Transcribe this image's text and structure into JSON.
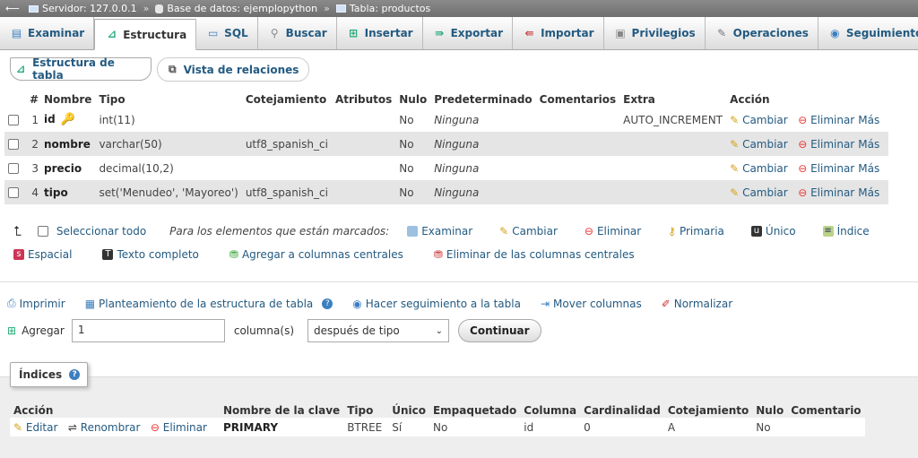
{
  "breadcrumb": {
    "server": "Servidor: 127.0.0.1",
    "database": "Base de datos: ejemplopython",
    "table": "Tabla: productos"
  },
  "tabs": [
    {
      "label": "Examinar",
      "icon": "browse-icon"
    },
    {
      "label": "Estructura",
      "icon": "structure-icon"
    },
    {
      "label": "SQL",
      "icon": "sql-icon"
    },
    {
      "label": "Buscar",
      "icon": "search-icon"
    },
    {
      "label": "Insertar",
      "icon": "insert-icon"
    },
    {
      "label": "Exportar",
      "icon": "export-icon"
    },
    {
      "label": "Importar",
      "icon": "import-icon"
    },
    {
      "label": "Privilegios",
      "icon": "privileges-icon"
    },
    {
      "label": "Operaciones",
      "icon": "wrench-icon"
    },
    {
      "label": "Seguimiento",
      "icon": "eye-icon"
    }
  ],
  "subtabs": {
    "structure": "Estructura de tabla",
    "relations": "Vista de relaciones"
  },
  "columns_header": [
    "#",
    "Nombre",
    "Tipo",
    "Cotejamiento",
    "Atributos",
    "Nulo",
    "Predeterminado",
    "Comentarios",
    "Extra",
    "Acción"
  ],
  "rows": [
    {
      "num": "1",
      "name": "id",
      "type": "int(11)",
      "collation": "",
      "attributes": "",
      "null": "No",
      "default": "Ninguna",
      "comments": "",
      "extra": "AUTO_INCREMENT",
      "change": "Cambiar",
      "drop": "Eliminar",
      "more": "Más"
    },
    {
      "num": "2",
      "name": "nombre",
      "type": "varchar(50)",
      "collation": "utf8_spanish_ci",
      "attributes": "",
      "null": "No",
      "default": "Ninguna",
      "comments": "",
      "extra": "",
      "change": "Cambiar",
      "drop": "Eliminar",
      "more": "Más"
    },
    {
      "num": "3",
      "name": "precio",
      "type": "decimal(10,2)",
      "collation": "",
      "attributes": "",
      "null": "No",
      "default": "Ninguna",
      "comments": "",
      "extra": "",
      "change": "Cambiar",
      "drop": "Eliminar",
      "more": "Más"
    },
    {
      "num": "4",
      "name": "tipo",
      "type": "set('Menudeo', 'Mayoreo')",
      "collation": "utf8_spanish_ci",
      "attributes": "",
      "null": "No",
      "default": "Ninguna",
      "comments": "",
      "extra": "",
      "change": "Cambiar",
      "drop": "Eliminar",
      "more": "Más"
    }
  ],
  "bulk": {
    "select_all": "Seleccionar todo",
    "for_selected": "Para los elementos que están marcados:",
    "browse": "Examinar",
    "change": "Cambiar",
    "drop": "Eliminar",
    "primary": "Primaria",
    "unique": "Único",
    "index": "Índice",
    "spatial": "Espacial",
    "fulltext": "Texto completo",
    "add_central": "Agregar a columnas centrales",
    "remove_central": "Eliminar de las columnas centrales"
  },
  "tools": {
    "print": "Imprimir",
    "propose": "Planteamiento de la estructura de tabla",
    "track": "Hacer seguimiento a la tabla",
    "move": "Mover columnas",
    "normalize": "Normalizar"
  },
  "add": {
    "label": "Agregar",
    "value": "1",
    "columns_label": "columna(s)",
    "position": "después de tipo",
    "button": "Continuar"
  },
  "indexes": {
    "legend": "Índices",
    "headers": [
      "Acción",
      "Nombre de la clave",
      "Tipo",
      "Único",
      "Empaquetado",
      "Columna",
      "Cardinalidad",
      "Cotejamiento",
      "Nulo",
      "Comentario"
    ],
    "row": {
      "edit": "Editar",
      "rename": "Renombrar",
      "drop": "Eliminar",
      "keyname": "PRIMARY",
      "type": "BTREE",
      "unique": "Sí",
      "packed": "No",
      "column": "id",
      "cardinality": "0",
      "collation": "A",
      "null": "No",
      "comment": ""
    }
  }
}
